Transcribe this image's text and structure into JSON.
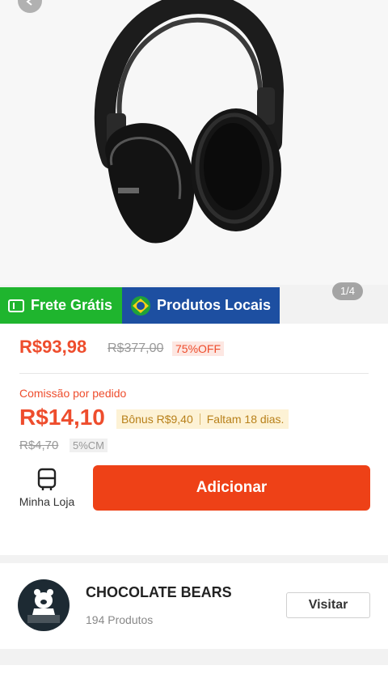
{
  "gallery": {
    "page_indicator": "1/4",
    "image_icon": "headphones-product-image"
  },
  "badges": {
    "free_shipping": "Frete Grátis",
    "local_products": "Produtos Locais"
  },
  "pricing": {
    "price": "R$93,98",
    "original_price": "R$377,00",
    "discount": "75%OFF"
  },
  "commission": {
    "label": "Comissão por pedido",
    "value": "R$14,10",
    "bonus": "Bônus R$9,40",
    "remaining": "Faltam 18 dias.",
    "old_value": "R$4,70",
    "rate": "5%CM"
  },
  "actions": {
    "my_store_label": "Minha Loja",
    "add_label": "Adicionar"
  },
  "shop": {
    "name": "CHOCOLATE BEARS",
    "product_count": "194 Produtos",
    "visit_label": "Visitar"
  },
  "colors": {
    "accent": "#ee4d2d",
    "free_shipping_bg": "#1fb52e",
    "local_bg": "#1d4fa1"
  }
}
